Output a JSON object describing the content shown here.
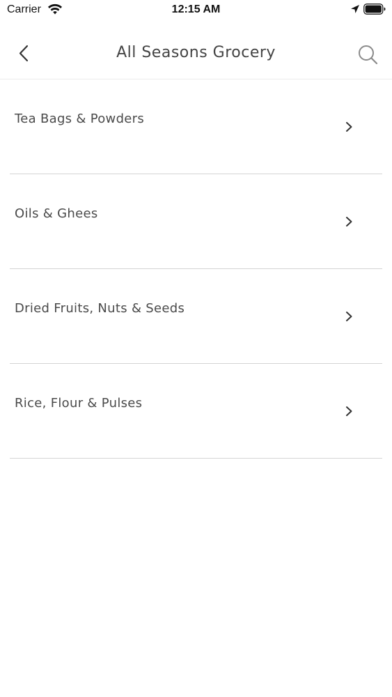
{
  "status_bar": {
    "carrier": "Carrier",
    "time": "12:15 AM",
    "icons": [
      "wifi-icon",
      "location-arrow-icon",
      "battery-icon"
    ]
  },
  "nav": {
    "title": "All Seasons Grocery",
    "back_icon": "chevron-left-icon",
    "search_icon": "search-icon"
  },
  "categories": [
    {
      "label": "Tea Bags & Powders"
    },
    {
      "label": "Oils & Ghees"
    },
    {
      "label": "Dried Fruits, Nuts & Seeds"
    },
    {
      "label": "Rice, Flour & Pulses"
    }
  ],
  "colors": {
    "background": "#ffffff",
    "text": "#4a4a4a",
    "divider": "#d4d4d4"
  }
}
